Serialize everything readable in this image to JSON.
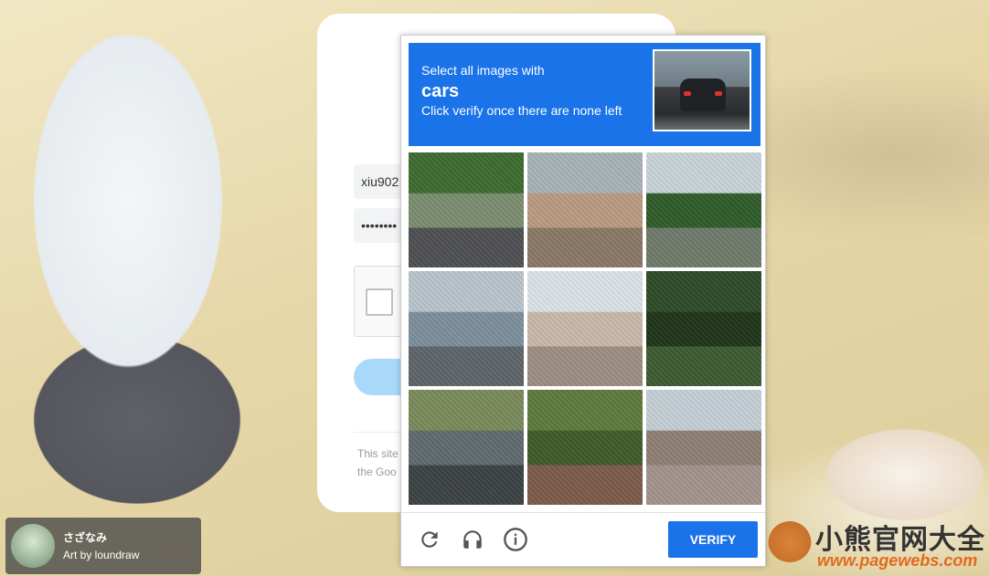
{
  "login": {
    "username_value": "xiu902",
    "password_value": "••••••••",
    "notice_line1": "This site",
    "notice_line2": "the Goo"
  },
  "challenge": {
    "instruction_line1": "Select all images with",
    "keyword": "cars",
    "instruction_line2": "Click verify once there are none left",
    "sample_image_icon": "car-rear-view",
    "tiles": [
      {
        "name": "tile-street-trees",
        "colors": [
          "#3d6b2f",
          "#7a8c6e",
          "#4e4f52"
        ]
      },
      {
        "name": "tile-bridge-road",
        "colors": [
          "#a7b3b8",
          "#b89a80",
          "#8a7866"
        ]
      },
      {
        "name": "tile-tall-trees",
        "colors": [
          "#c8d3d8",
          "#2f5a2a",
          "#6e7a6a"
        ]
      },
      {
        "name": "tile-town-street",
        "colors": [
          "#b8c4cc",
          "#7c8e9c",
          "#5f6468"
        ]
      },
      {
        "name": "tile-sidewalk-pole",
        "colors": [
          "#dbe2e6",
          "#c9b8a8",
          "#9d8d82"
        ]
      },
      {
        "name": "tile-palm-tree",
        "colors": [
          "#2e4a26",
          "#1f3418",
          "#3c5a31"
        ]
      },
      {
        "name": "tile-parked-cars-street",
        "colors": [
          "#7a8a5a",
          "#5f6a6e",
          "#3c4144"
        ]
      },
      {
        "name": "tile-bushes",
        "colors": [
          "#5d7a3a",
          "#3e5a2a",
          "#7c5a4a"
        ]
      },
      {
        "name": "tile-roof",
        "colors": [
          "#c4ced4",
          "#8e7e74",
          "#a0948c"
        ]
      }
    ],
    "reload_icon": "reload-icon",
    "audio_icon": "headphones-icon",
    "info_icon": "info-icon",
    "verify_label": "VERIFY",
    "accent_color": "#1a73e8"
  },
  "credit": {
    "name": "さざなみ",
    "by": "Art by loundraw"
  },
  "watermark": {
    "title": "小熊官网大全",
    "url": "www.pagewebs.com"
  }
}
